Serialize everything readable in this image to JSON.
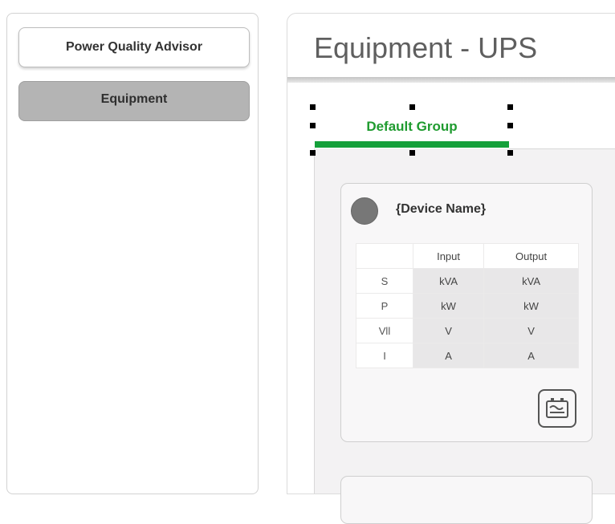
{
  "sidebar": {
    "items": [
      {
        "label": "Power Quality Advisor"
      },
      {
        "label": "Equipment"
      }
    ]
  },
  "main": {
    "title": "Equipment - UPS",
    "tabs": [
      {
        "label": "Default Group",
        "active": true
      }
    ]
  },
  "device_card": {
    "name": "{Device Name}",
    "status_icon": "status-dot",
    "table": {
      "columns": [
        "",
        "Input",
        "Output"
      ],
      "rows": [
        {
          "label": "S",
          "input": "kVA",
          "output": "kVA"
        },
        {
          "label": "P",
          "input": "kW",
          "output": "kW"
        },
        {
          "label": "Vll",
          "input": "V",
          "output": "V"
        },
        {
          "label": "I",
          "input": "A",
          "output": "A"
        }
      ]
    },
    "action_icon": "ups-battery-icon"
  },
  "colors": {
    "accent": "#14a03a",
    "tab_text": "#1f9b2f",
    "selected_nav": "#b4b4b4",
    "status_dot": "#777777"
  }
}
